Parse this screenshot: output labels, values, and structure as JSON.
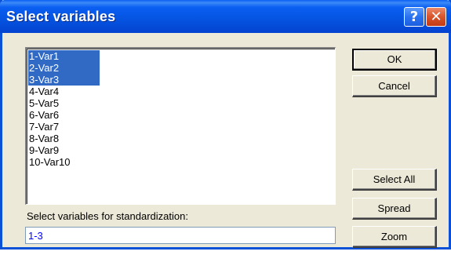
{
  "window": {
    "title": "Select variables",
    "help_label": "?",
    "close_label": "✕"
  },
  "variables_list": {
    "items": [
      {
        "label": "1-Var1",
        "selected": true
      },
      {
        "label": "2-Var2",
        "selected": true
      },
      {
        "label": "3-Var3",
        "selected": true
      },
      {
        "label": "4-Var4",
        "selected": false
      },
      {
        "label": "5-Var5",
        "selected": false
      },
      {
        "label": "6-Var6",
        "selected": false
      },
      {
        "label": "7-Var7",
        "selected": false
      },
      {
        "label": "8-Var8",
        "selected": false
      },
      {
        "label": "9-Var9",
        "selected": false
      },
      {
        "label": "10-Var10",
        "selected": false
      }
    ]
  },
  "selection": {
    "label": "Select variables for standardization:",
    "value": "1-3"
  },
  "buttons": {
    "ok": "OK",
    "cancel": "Cancel",
    "select_all": "Select All",
    "spread": "Spread",
    "zoom": "Zoom"
  },
  "colors": {
    "selection_highlight": "#316ac5",
    "field_text": "#0000ff",
    "titlebar": "#0553e0",
    "close_button": "#d8542a"
  }
}
